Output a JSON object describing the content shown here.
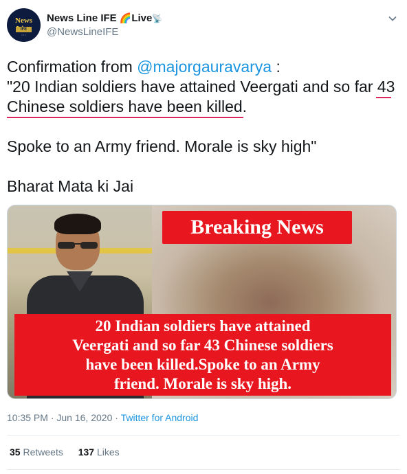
{
  "account": {
    "display_name": "News Line IFE",
    "live_label": "Live",
    "handle": "@NewsLineIFE",
    "avatar_text": "News Line",
    "avatar_subtext": "IFE"
  },
  "tweet": {
    "lead": "Confirmation from ",
    "mention": "@majorgauravarya",
    "lead_suffix": "  :",
    "quote_line1": "\"20 Indian soldiers have attained Veergati and so far 43",
    "quote_line2": "Chinese soldiers have been killed.",
    "line3": "Spoke to an Army friend. Morale is sky high\"",
    "line4": "Bharat Mata ki Jai"
  },
  "media": {
    "headline": "Breaking News",
    "banner_lines": [
      "20 Indian soldiers have attained",
      "Veergati and so far 43 Chinese soldiers",
      "have been killed.Spoke to an Army",
      "friend. Morale is sky high."
    ]
  },
  "meta": {
    "time": "10:35 PM",
    "sep1": " · ",
    "date": "Jun 16, 2020",
    "sep2": " · ",
    "source": "Twitter for Android"
  },
  "stats": {
    "retweets_count": "35",
    "retweets_label": "Retweets",
    "likes_count": "137",
    "likes_label": "Likes"
  },
  "icons": {
    "rainbow": "rainbow-icon",
    "satellite": "satellite-icon",
    "caret": "chevron-down-icon"
  },
  "colors": {
    "link": "#1b95e0",
    "text": "#14171a",
    "muted": "#657786",
    "underline_mark": "#e0245e",
    "banner_red": "#e8171f"
  }
}
